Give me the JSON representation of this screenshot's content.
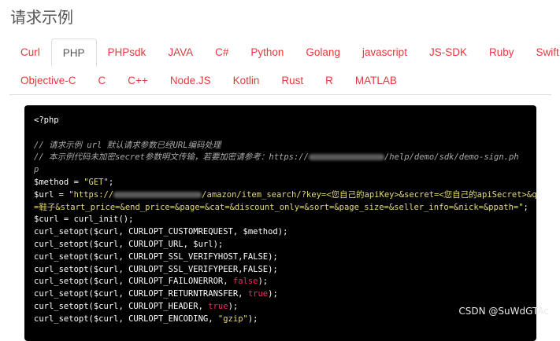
{
  "section_title": "请求示例",
  "tabs": [
    {
      "label": "Curl",
      "active": false
    },
    {
      "label": "PHP",
      "active": true
    },
    {
      "label": "PHPsdk",
      "active": false
    },
    {
      "label": "JAVA",
      "active": false
    },
    {
      "label": "C#",
      "active": false
    },
    {
      "label": "Python",
      "active": false
    },
    {
      "label": "Golang",
      "active": false
    },
    {
      "label": "javascript",
      "active": false
    },
    {
      "label": "JS-SDK",
      "active": false
    },
    {
      "label": "Ruby",
      "active": false
    },
    {
      "label": "Swift",
      "active": false
    },
    {
      "label": "Objective-C",
      "active": false
    },
    {
      "label": "C",
      "active": false
    },
    {
      "label": "C++",
      "active": false
    },
    {
      "label": "Node.JS",
      "active": false
    },
    {
      "label": "Kotlin",
      "active": false
    },
    {
      "label": "Rust",
      "active": false
    },
    {
      "label": "R",
      "active": false
    },
    {
      "label": "MATLAB",
      "active": false
    }
  ],
  "code": {
    "open_tag": "<?php",
    "comment_1": "// 请求示例 url 默认请求参数已经URL编码处理",
    "comment_2a": "// 本示例代码未加密secret参数明文传输，若要加密请参考：https://",
    "comment_2b": "/help/demo/sdk/demo-sign.ph",
    "comment_2c": "p",
    "method_pre": "$method = ",
    "method_val": "\"GET\"",
    "method_post": ";",
    "url_pre": "$url = ",
    "url_val_a": "\"https://",
    "url_val_b": "/amazon/item_search/?key=<您自己的apiKey>&secret=<您自己的apiSecret>&q",
    "url_val_c": "=鞋子&start_price=&end_price=&page=&cat=&discount_only=&sort=&page_size=&seller_info=&nick=&ppath=\"",
    "url_post": ";",
    "curl_init": "$curl = curl_init();",
    "opt_customrequest": "curl_setopt($curl, CURLOPT_CUSTOMREQUEST, $method);",
    "opt_url": "curl_setopt($curl, CURLOPT_URL, $url);",
    "opt_verifyhost": "curl_setopt($curl, CURLOPT_SSL_VERIFYHOST,FALSE);",
    "opt_verifypeer": "curl_setopt($curl, CURLOPT_SSL_VERIFYPEER,FALSE);",
    "opt_failonerror_pre": "curl_setopt($curl, CURLOPT_FAILONERROR, ",
    "opt_failonerror_val": "false",
    "opt_returntransfer_pre": "curl_setopt($curl, CURLOPT_RETURNTRANSFER, ",
    "opt_returntransfer_val": "true",
    "opt_header_pre": "curl_setopt($curl, CURLOPT_HEADER, ",
    "opt_header_val": "true",
    "opt_encoding_pre": "curl_setopt($curl, CURLOPT_ENCODING, ",
    "opt_encoding_val": "\"gzip\"",
    "close": ");"
  },
  "watermark": "CSDN @SuWdGTAc"
}
